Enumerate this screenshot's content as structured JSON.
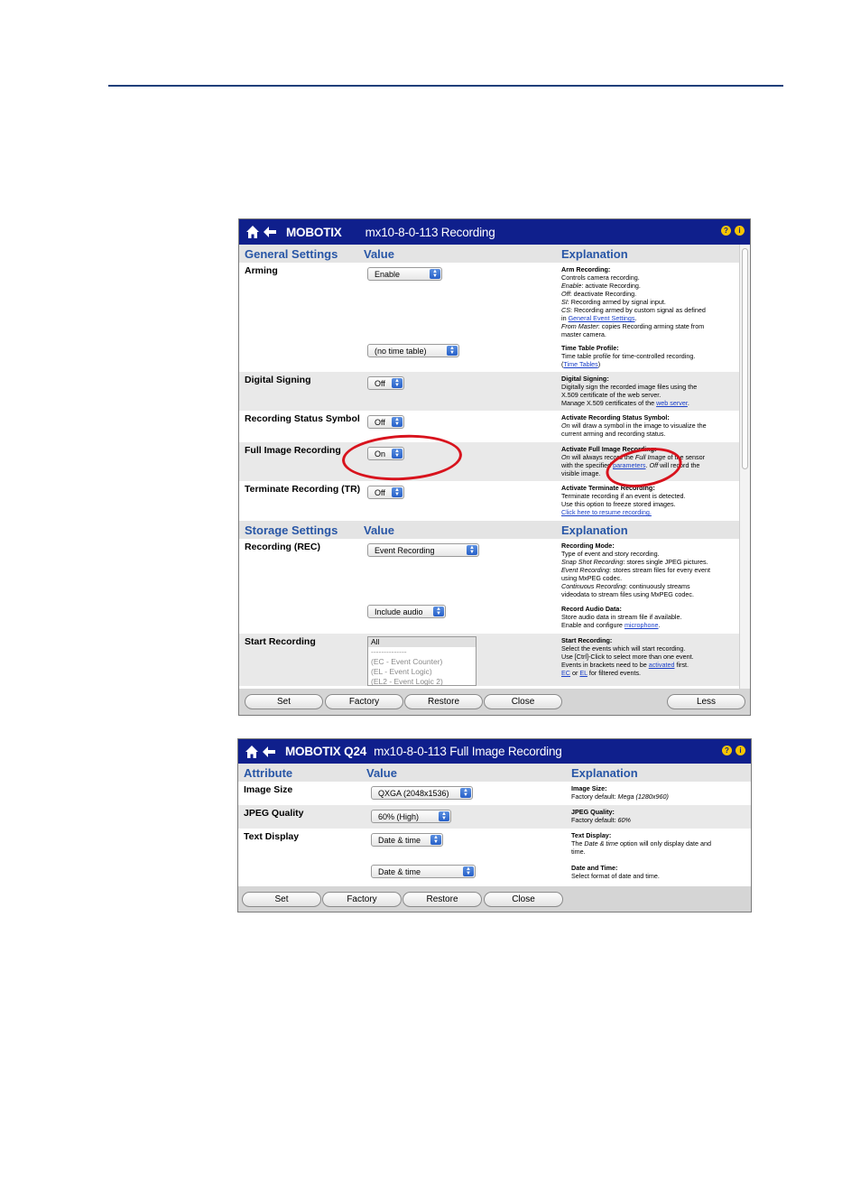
{
  "window1": {
    "brand": "MOBOTIX",
    "title": "mx10-8-0-113 Recording",
    "general": {
      "h_attr": "General Settings",
      "h_value": "Value",
      "h_expl": "Explanation",
      "arming": {
        "label": "Arming",
        "select": "Enable",
        "e_title": "Arm Recording",
        "e1": "Controls camera recording.",
        "e2_em": "Enable",
        "e2": ": activate Recording.",
        "e3_em": "Off",
        "e3": ": deactivate Recording.",
        "e4_em": "SI",
        "e4": ": Recording armed by signal input.",
        "e5_em": "CS",
        "e5": ": Recording armed by custom signal as defined",
        "e6": "in ",
        "e6_link": "General Event Settings",
        "e6_end": ".",
        "e7_em": "From Master",
        "e7": ": copies Recording arming state from",
        "e8": "master camera."
      },
      "timetable": {
        "select": "(no time table)",
        "e_title": "Time Table Profile",
        "e1": "Time table profile for time-controlled recording.",
        "e2_open": "(",
        "e2_link": "Time Tables",
        "e2_close": ")"
      },
      "signing": {
        "label": "Digital Signing",
        "select": "Off",
        "e_title": "Digital Signing",
        "e1": "Digitally sign the recorded image files using the",
        "e2": "X.509 certificate of the web server.",
        "e3": "Manage X.509 certificates of the ",
        "e3_link": "web server",
        "e3_end": "."
      },
      "status_symbol": {
        "label": "Recording Status Symbol",
        "select": "Off",
        "e_title": "Activate Recording Status Symbol",
        "e1_em": "On",
        "e1": " will draw a symbol in the image to visualize the",
        "e2": "current arming and recording status."
      },
      "full_image": {
        "label": "Full Image Recording",
        "select": "On",
        "e_title": "Activate Full Image Recording",
        "e1_em": "On",
        "e1": " will always record the ",
        "e1_em2": "Full Image",
        "e1_end": " of the sensor",
        "e2": "with the specified ",
        "e2_link": "parameters",
        "e2_mid": ". ",
        "e2_em": "Off",
        "e2_end": " will record the",
        "e3": "visible image."
      },
      "terminate": {
        "label": "Terminate Recording (TR)",
        "select": "Off",
        "e_title": "Activate Terminate Recording",
        "e1": "Terminate recording if an event is detected.",
        "e2": "Use this option to freeze stored images.",
        "e3_link": "Click here to resume recording."
      }
    },
    "storage": {
      "h_attr": "Storage Settings",
      "h_value": "Value",
      "h_expl": "Explanation",
      "recording": {
        "label": "Recording (REC)",
        "select": "Event Recording",
        "e_title": "Recording Mode",
        "e1": "Type of event and story recording.",
        "e2_em": "Snap Shot Recording",
        "e2": ": stores single JPEG pictures.",
        "e3_em": "Event Recording",
        "e3": ": stores stream files for every event",
        "e4": "using MxPEG codec.",
        "e5_em": "Continuous Recording",
        "e5": ": continuously streams",
        "e6": "videodata to stream files using MxPEG codec."
      },
      "audio": {
        "select": "Include audio",
        "e_title": "Record Audio Data",
        "e1": "Store audio data in stream file if available.",
        "e2": "Enable and configure ",
        "e2_link": "microphone",
        "e2_end": "."
      },
      "start": {
        "label": "Start Recording",
        "options": [
          "All",
          "--------------",
          "(EC - Event Counter)",
          "(EL - Event Logic)",
          "(EL2 - Event Logic 2)"
        ],
        "e_title": "Start Recording",
        "e1": "Select the events which will start recording.",
        "e2": "Use [Ctrl]-Click to select more than one event.",
        "e3": "Events in brackets need to be ",
        "e3_link": "activated",
        "e3_end": " first.",
        "e4_link1": "EC",
        "e4_mid": " or ",
        "e4_link2": "EL",
        "e4_end": " for filtered events."
      }
    },
    "buttons": {
      "set": "Set",
      "factory": "Factory",
      "restore": "Restore",
      "close": "Close",
      "less": "Less"
    }
  },
  "window2": {
    "brand": "MOBOTIX Q24",
    "title": "mx10-8-0-113 Full Image Recording",
    "h_attr": "Attribute",
    "h_value": "Value",
    "h_expl": "Explanation",
    "image_size": {
      "label": "Image Size",
      "select": "QXGA (2048x1536)",
      "e_title": "Image Size",
      "e1": "Factory default: ",
      "e1_em": "Mega (1280x960)"
    },
    "jpeg": {
      "label": "JPEG Quality",
      "select": "60% (High)",
      "e_title": "JPEG Quality",
      "e1": "Factory default: ",
      "e1_em": "60%"
    },
    "text_display": {
      "label": "Text Display",
      "select": "Date & time",
      "e_title": "Text Display",
      "e1": "The ",
      "e1_em": "Date & time",
      "e1_end": " option will only display date and",
      "e2": "time."
    },
    "date_time": {
      "select": "Date & time",
      "e_title": "Date and Time",
      "e1": "Select format of date and time."
    },
    "buttons": {
      "set": "Set",
      "factory": "Factory",
      "restore": "Restore",
      "close": "Close"
    }
  },
  "colors": {
    "titlebar": "#0f1f8c",
    "header_text": "#2856a6",
    "highlight_circle": "#d8131d",
    "rule": "#1d3f7a"
  },
  "icons": [
    "home-icon",
    "back-arrow-icon",
    "help-icon",
    "info-icon"
  ]
}
